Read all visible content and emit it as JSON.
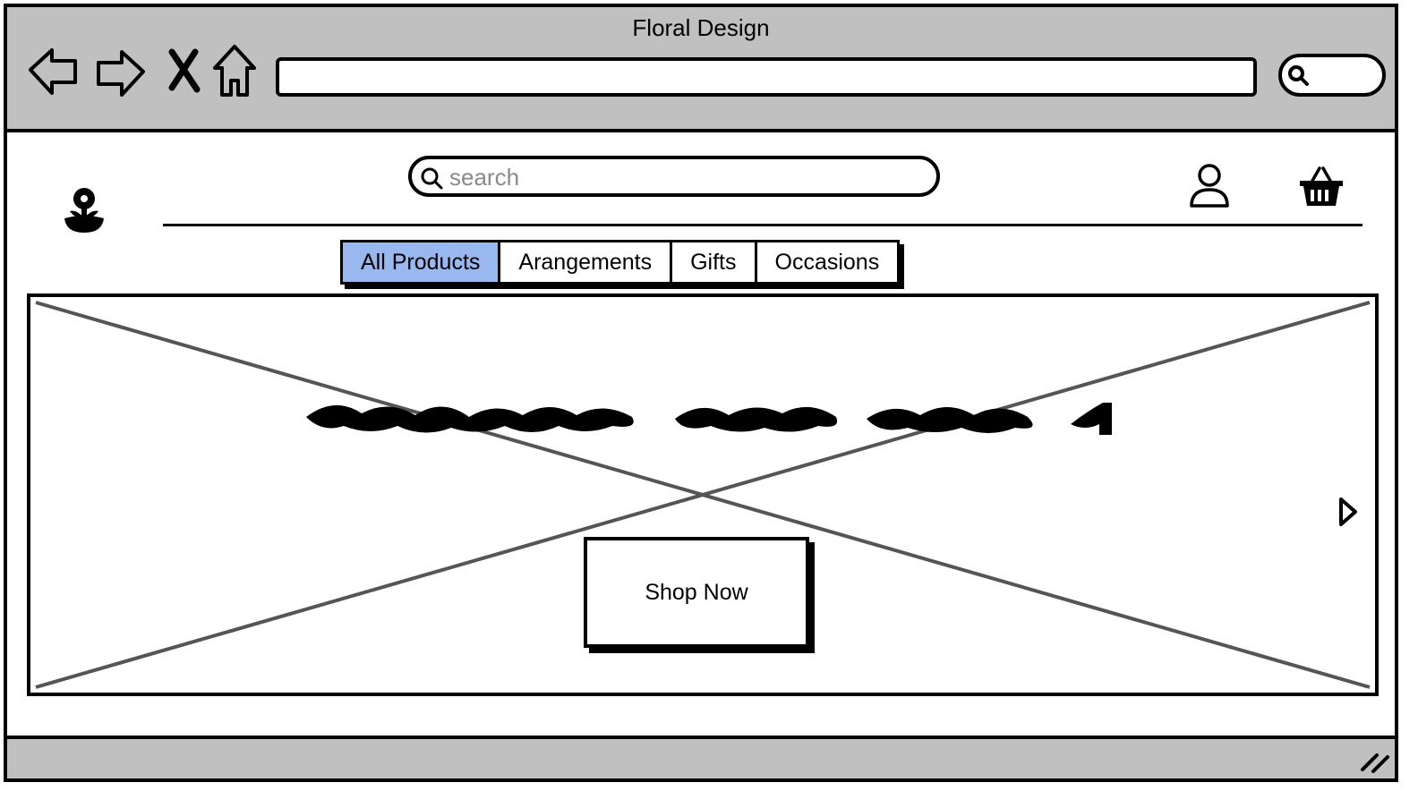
{
  "window": {
    "title": "Floral Design"
  },
  "browser": {
    "back_icon": "arrow-left-icon",
    "forward_icon": "arrow-right-icon",
    "stop_icon": "close-icon",
    "home_icon": "home-icon",
    "address_value": "",
    "search_icon": "search-icon"
  },
  "header": {
    "logo_icon": "flower-icon",
    "search": {
      "placeholder": "search",
      "value": "",
      "icon": "search-icon"
    },
    "account_icon": "user-icon",
    "cart_icon": "basket-icon"
  },
  "tabs": [
    {
      "label": "All Products",
      "active": true
    },
    {
      "label": "Arangements",
      "active": false
    },
    {
      "label": "Gifts",
      "active": false
    },
    {
      "label": "Occasions",
      "active": false
    }
  ],
  "hero": {
    "image_placeholder": "image-placeholder",
    "next_icon": "chevron-right-icon",
    "cta_label": "Shop Now"
  },
  "colors": {
    "chrome": "#c0c0c0",
    "active_tab": "#99b8f0",
    "stroke": "#000000",
    "placeholder_cross": "#555555"
  }
}
